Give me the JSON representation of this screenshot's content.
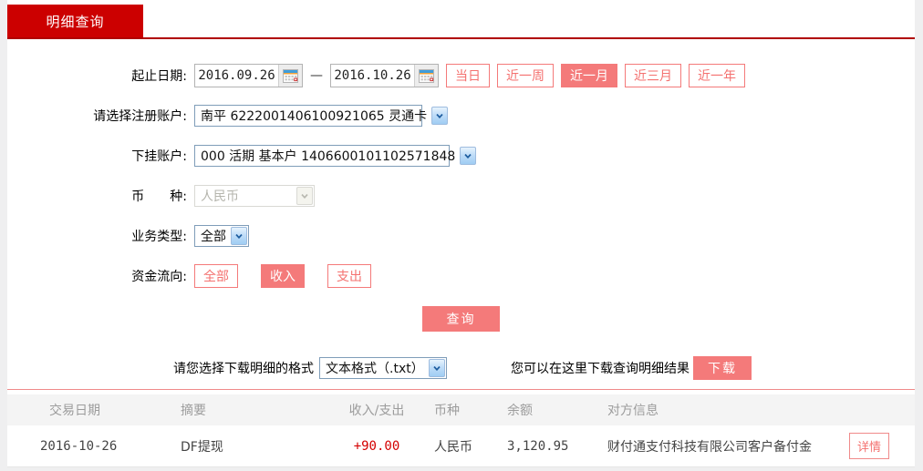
{
  "tab": {
    "label": "明细查询"
  },
  "form": {
    "date_range": {
      "label": "起止日期:",
      "start": "2016.09.26",
      "separator": "—",
      "end": "2016.10.26",
      "quick_buttons": [
        {
          "label": "当日",
          "selected": false
        },
        {
          "label": "近一周",
          "selected": false
        },
        {
          "label": "近一月",
          "selected": true
        },
        {
          "label": "近三月",
          "selected": false
        },
        {
          "label": "近一年",
          "selected": false
        }
      ]
    },
    "registered_account": {
      "label": "请选择注册账户:",
      "value": "南平 6222001406100921065 灵通卡"
    },
    "sub_account": {
      "label": "下挂账户:",
      "value": "000 活期 基本户 1406600101102571848"
    },
    "currency": {
      "label": "币　　种:",
      "value": "人民币",
      "disabled": true
    },
    "business_type": {
      "label": "业务类型:",
      "value": "全部"
    },
    "fund_flow": {
      "label": "资金流向:",
      "buttons": [
        {
          "label": "全部",
          "selected": false
        },
        {
          "label": "收入",
          "selected": true
        },
        {
          "label": "支出",
          "selected": false
        }
      ]
    },
    "query_button": "查询"
  },
  "download": {
    "format_label": "请您选择下载明细的格式",
    "format_value": "文本格式（.txt）",
    "hint": "您可以在这里下载查询明细结果",
    "button": "下载"
  },
  "table": {
    "headers": [
      "交易日期",
      "摘要",
      "收入/支出",
      "币种",
      "余额",
      "对方信息"
    ],
    "rows": [
      {
        "date": "2016-10-26",
        "summary": "DF提现",
        "amount": "+90.00",
        "currency": "人民币",
        "balance": "3,120.95",
        "counterparty": "财付通支付科技有限公司客户备付金",
        "detail_button": "详情"
      }
    ]
  },
  "colors": {
    "tab_red": "#cc0000",
    "underline_red": "#b00000",
    "accent_salmon": "#f47a7a",
    "amount_red": "#d40000"
  }
}
